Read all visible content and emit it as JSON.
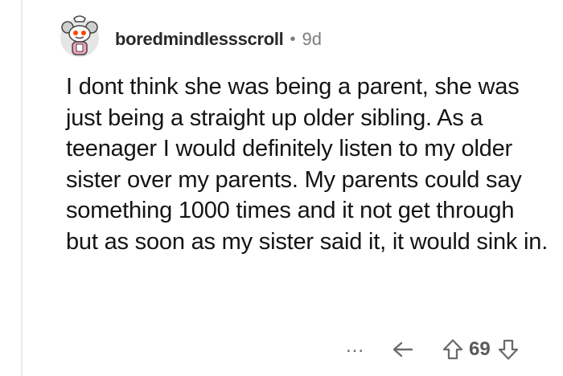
{
  "comment": {
    "author": "boredmindlessscroll",
    "separator": "•",
    "age": "9d",
    "body": "I dont think she was being a parent, she was just being a straight up older sibling. As a teenager I would definitely listen to my older sister over my parents. My parents could say something 1000 times and it not get through but as soon as my sister said it, it would sink in.",
    "score": "69"
  },
  "actions": {
    "more": "...",
    "icons": [
      "more-icon",
      "reply-icon",
      "upvote-icon",
      "downvote-icon"
    ]
  },
  "colors": {
    "text": "#1a1a1b",
    "meta": "#7c7c7c",
    "icon": "#6b6b6b",
    "thread_line": "#ececec",
    "avatar_bg": "#e4e4e4",
    "avatar_eye": "#ff4500"
  }
}
